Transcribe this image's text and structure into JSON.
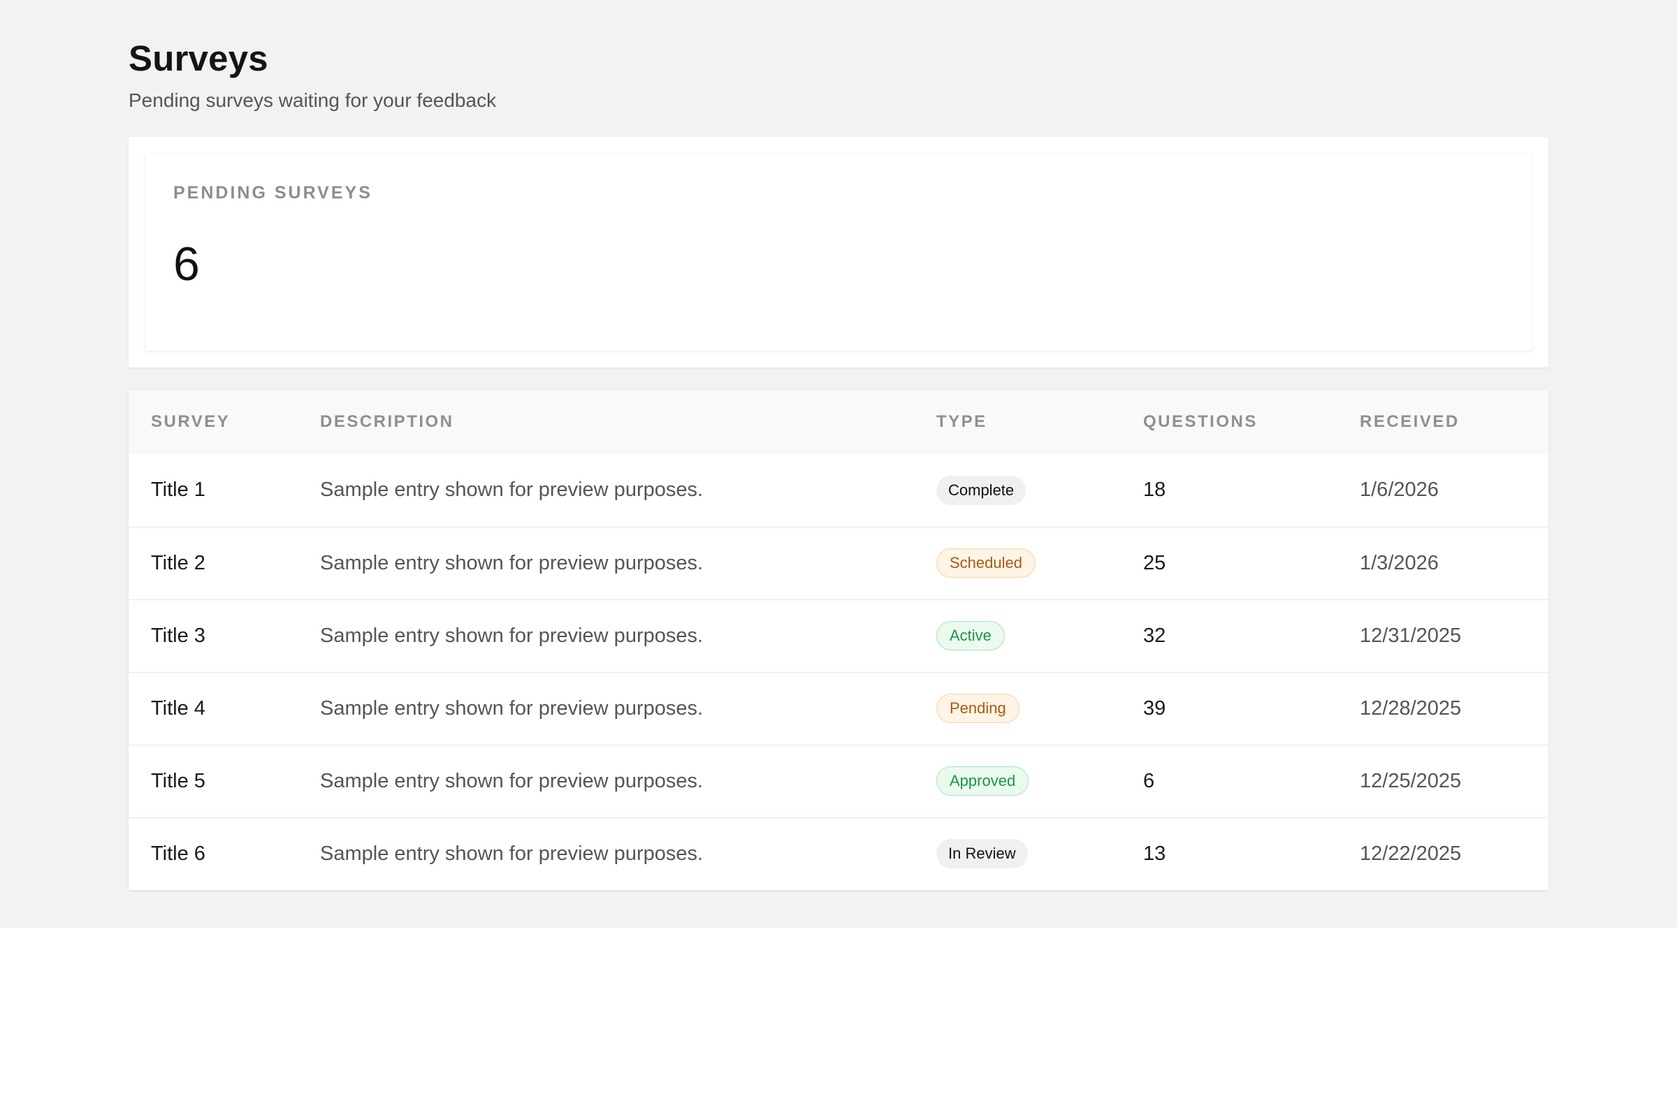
{
  "header": {
    "title": "Surveys",
    "subtitle": "Pending surveys waiting for your feedback"
  },
  "summary": {
    "label": "PENDING SURVEYS",
    "value": "6"
  },
  "table": {
    "columns": [
      "SURVEY",
      "DESCRIPTION",
      "TYPE",
      "QUESTIONS",
      "RECEIVED"
    ],
    "rows": [
      {
        "survey": "Title 1",
        "description": "Sample entry shown for preview purposes.",
        "type": "Complete",
        "type_style": "neutral",
        "questions": "18",
        "received": "1/6/2026"
      },
      {
        "survey": "Title 2",
        "description": "Sample entry shown for preview purposes.",
        "type": "Scheduled",
        "type_style": "warning",
        "questions": "25",
        "received": "1/3/2026"
      },
      {
        "survey": "Title 3",
        "description": "Sample entry shown for preview purposes.",
        "type": "Active",
        "type_style": "success",
        "questions": "32",
        "received": "12/31/2025"
      },
      {
        "survey": "Title 4",
        "description": "Sample entry shown for preview purposes.",
        "type": "Pending",
        "type_style": "warning",
        "questions": "39",
        "received": "12/28/2025"
      },
      {
        "survey": "Title 5",
        "description": "Sample entry shown for preview purposes.",
        "type": "Approved",
        "type_style": "success",
        "questions": "6",
        "received": "12/25/2025"
      },
      {
        "survey": "Title 6",
        "description": "Sample entry shown for preview purposes.",
        "type": "In Review",
        "type_style": "neutral",
        "questions": "13",
        "received": "12/22/2025"
      }
    ]
  },
  "colors": {
    "page_background": "#f2f2f2",
    "card_background": "#ffffff",
    "badge_neutral_bg": "#f0f0f0",
    "badge_warning_text": "#a85a10",
    "badge_warning_bg": "#fff4e6",
    "badge_success_text": "#1f9545",
    "badge_success_bg": "#eafaef"
  }
}
